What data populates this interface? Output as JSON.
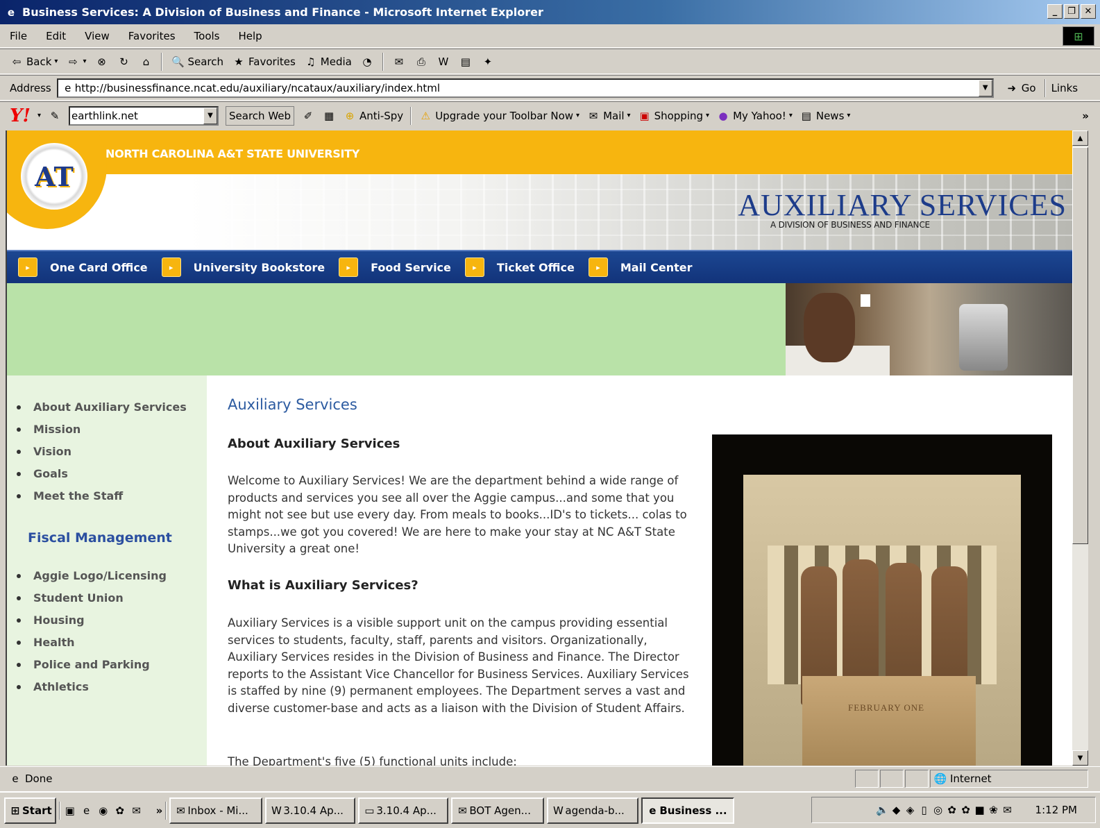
{
  "window": {
    "title": "Business Services: A Division of Business and Finance - Microsoft Internet Explorer"
  },
  "menu": [
    "File",
    "Edit",
    "View",
    "Favorites",
    "Tools",
    "Help"
  ],
  "toolbar": {
    "back": "Back",
    "search": "Search",
    "favorites": "Favorites",
    "media": "Media"
  },
  "address": {
    "label": "Address",
    "url": "http://businessfinance.ncat.edu/auxiliary/ncataux/auxiliary/index.html",
    "go": "Go",
    "links": "Links"
  },
  "yahoo": {
    "logo": "Y!",
    "search_value": "earthlink.net",
    "search_web": "Search Web",
    "anti_spy": "Anti-Spy",
    "upgrade": "Upgrade your Toolbar Now",
    "mail": "Mail",
    "shopping": "Shopping",
    "my_yahoo": "My Yahoo!",
    "news": "News",
    "more": "»"
  },
  "header": {
    "university": "NORTH CAROLINA A&T STATE UNIVERSITY",
    "title": "AUXILIARY SERVICES",
    "subtitle": "A DIVISION OF BUSINESS AND FINANCE",
    "logo": "AT"
  },
  "nav": [
    "One Card Office",
    "University Bookstore",
    "Food Service",
    "Ticket Office",
    "Mail Center"
  ],
  "sidebar": {
    "group1": [
      "About Auxiliary Services",
      "Mission",
      "Vision",
      "Goals",
      "Meet the Staff"
    ],
    "fiscal_heading": "Fiscal Management",
    "group2": [
      "Aggie Logo/Licensing",
      "Student Union",
      "Housing",
      "Health",
      "Police and Parking",
      "Athletics"
    ]
  },
  "main": {
    "title": "Auxiliary Services",
    "h_about": "About Auxiliary Services",
    "p_about": "Welcome to Auxiliary Services! We are the department behind a wide range of products and services you see all over the Aggie campus...and some that you might not see but use every day. From meals to books...ID's to tickets... colas to stamps...we got you covered! We are here to make your stay at NC A&T State University a great one!",
    "h_what": "What is Auxiliary Services?",
    "p_what": "Auxiliary Services is a visible support unit on the campus providing essential services to students, faculty, staff, parents and visitors. Organizationally, Auxiliary Services resides in the Division of Business and Finance. The Director reports to the Assistant Vice Chancellor for Business Services. Auxiliary Services is staffed by nine (9) permanent employees. The Department serves a vast and diverse customer-base and acts as a liaison with the Division of Student Affairs.",
    "p_units": "The Department's five (5) functional units include:",
    "plaque": "FEBRUARY ONE"
  },
  "status": {
    "text": "Done",
    "zone": "Internet"
  },
  "taskbar": {
    "start": "Start",
    "more": "»",
    "buttons": [
      "Inbox - Mi...",
      "3.10.4 Ap...",
      "3.10.4 Ap...",
      "BOT Agen...",
      "agenda-b...",
      "Business ..."
    ],
    "clock": "1:12 PM"
  }
}
